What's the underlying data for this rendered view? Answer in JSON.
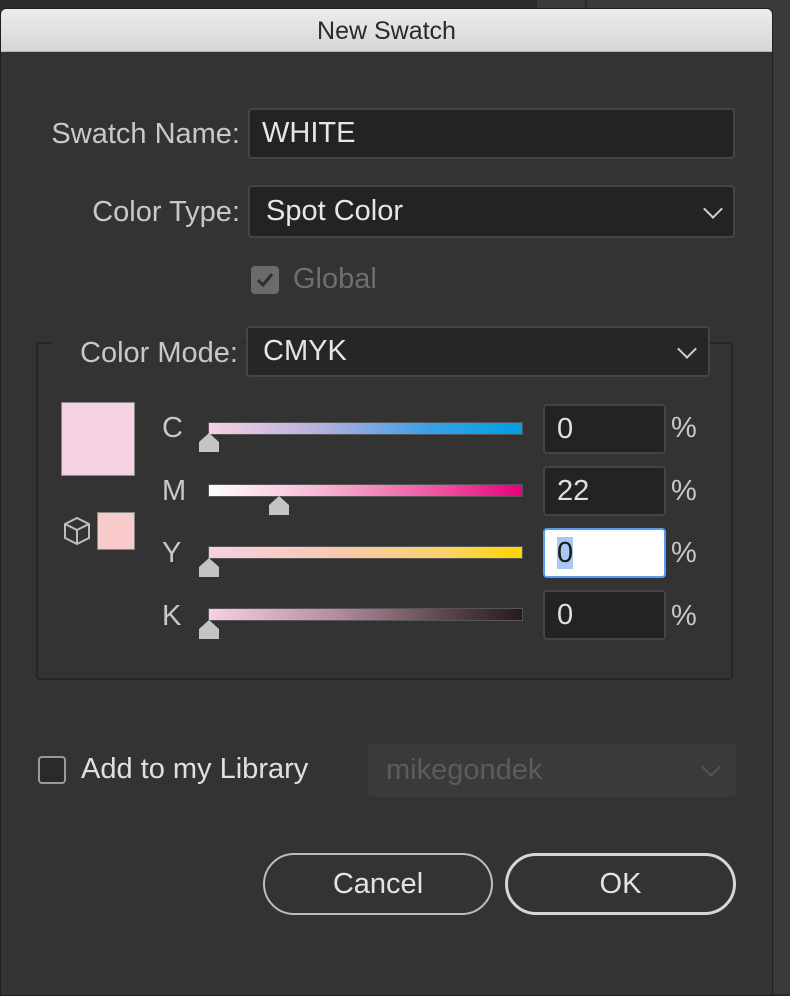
{
  "dialog": {
    "title": "New Swatch"
  },
  "swatch_name": {
    "label": "Swatch Name:",
    "value": "WHITE"
  },
  "color_type": {
    "label": "Color Type:",
    "value": "Spot Color"
  },
  "global": {
    "label": "Global",
    "checked": true,
    "enabled": false
  },
  "color_mode": {
    "label": "Color Mode:",
    "value": "CMYK"
  },
  "preview": {
    "color": "#f6d0e3",
    "gamut_color": "#f8caca"
  },
  "channels": [
    {
      "name": "C",
      "value": "0",
      "unit": "%",
      "level": 0
    },
    {
      "name": "M",
      "value": "22",
      "unit": "%",
      "level": 22
    },
    {
      "name": "Y",
      "value": "0",
      "unit": "%",
      "level": 0
    },
    {
      "name": "K",
      "value": "0",
      "unit": "%",
      "level": 0
    }
  ],
  "library": {
    "label": "Add to my Library",
    "checked": false,
    "selected": "mikegondek"
  },
  "buttons": {
    "cancel": "Cancel",
    "ok": "OK"
  },
  "colors": {
    "accent_focus": "#5a9cf0",
    "dialog_bg": "#333333"
  }
}
